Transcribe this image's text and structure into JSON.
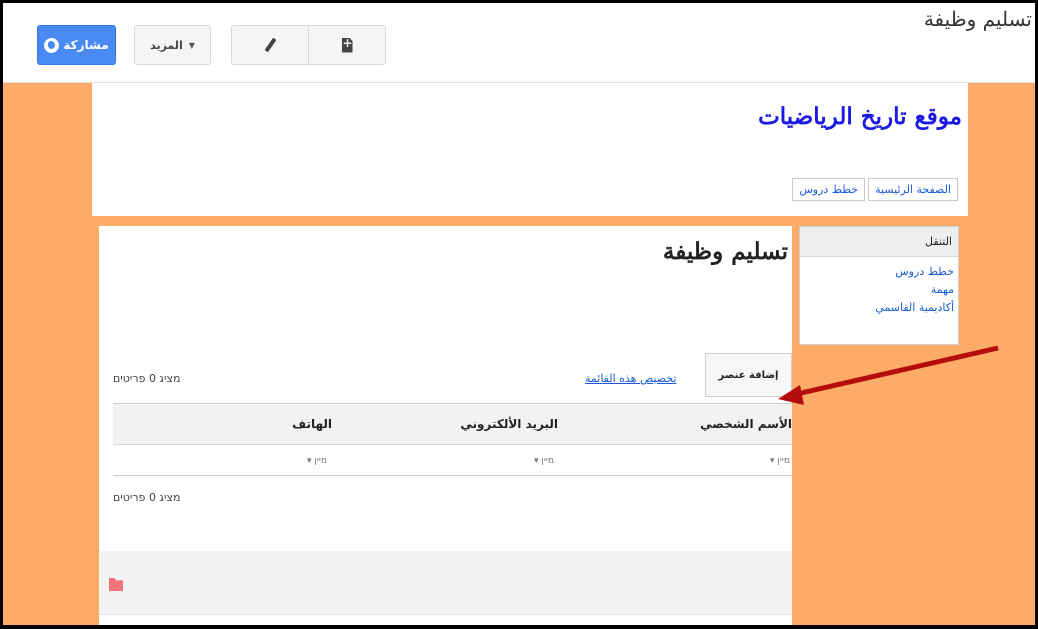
{
  "toolbar": {
    "share_label": "مشاركة",
    "more_label": "المزيد",
    "doc_title": "تسليم وظيفة"
  },
  "site": {
    "title": "موقع تاريخ الرياضيات",
    "nav_tabs": [
      {
        "label": "الصفحة الرئيسية"
      },
      {
        "label": "خطط دروس"
      }
    ]
  },
  "sidebar": {
    "heading": "التنقل",
    "links": [
      {
        "label": "خطط دروس"
      },
      {
        "label": "مهمة"
      },
      {
        "label": "أكاديمية القاسمي"
      }
    ]
  },
  "content": {
    "title": "تسليم وظيفة",
    "add_item_label": "إضافة عنصر",
    "customize_label": "تخصيص هذه القائمة",
    "count_text": "מציג 0 פריטים",
    "columns": [
      {
        "label": "الأسم الشخصي",
        "filter": "מיין"
      },
      {
        "label": "البريد الألكتروني",
        "filter": "מיין"
      },
      {
        "label": "الهاتف",
        "filter": "מיין"
      }
    ]
  },
  "colors": {
    "page_background": "#fdab66",
    "share_button": "#4a8af4",
    "link": "#1a5bd6",
    "site_title": "#1a1ae0",
    "arrow": "#b50d0d",
    "folder": "#f4747a"
  },
  "icons": [
    "globe-icon",
    "caret-down-icon",
    "new-page-icon",
    "pencil-icon",
    "folder-icon",
    "arrow-annotation"
  ]
}
